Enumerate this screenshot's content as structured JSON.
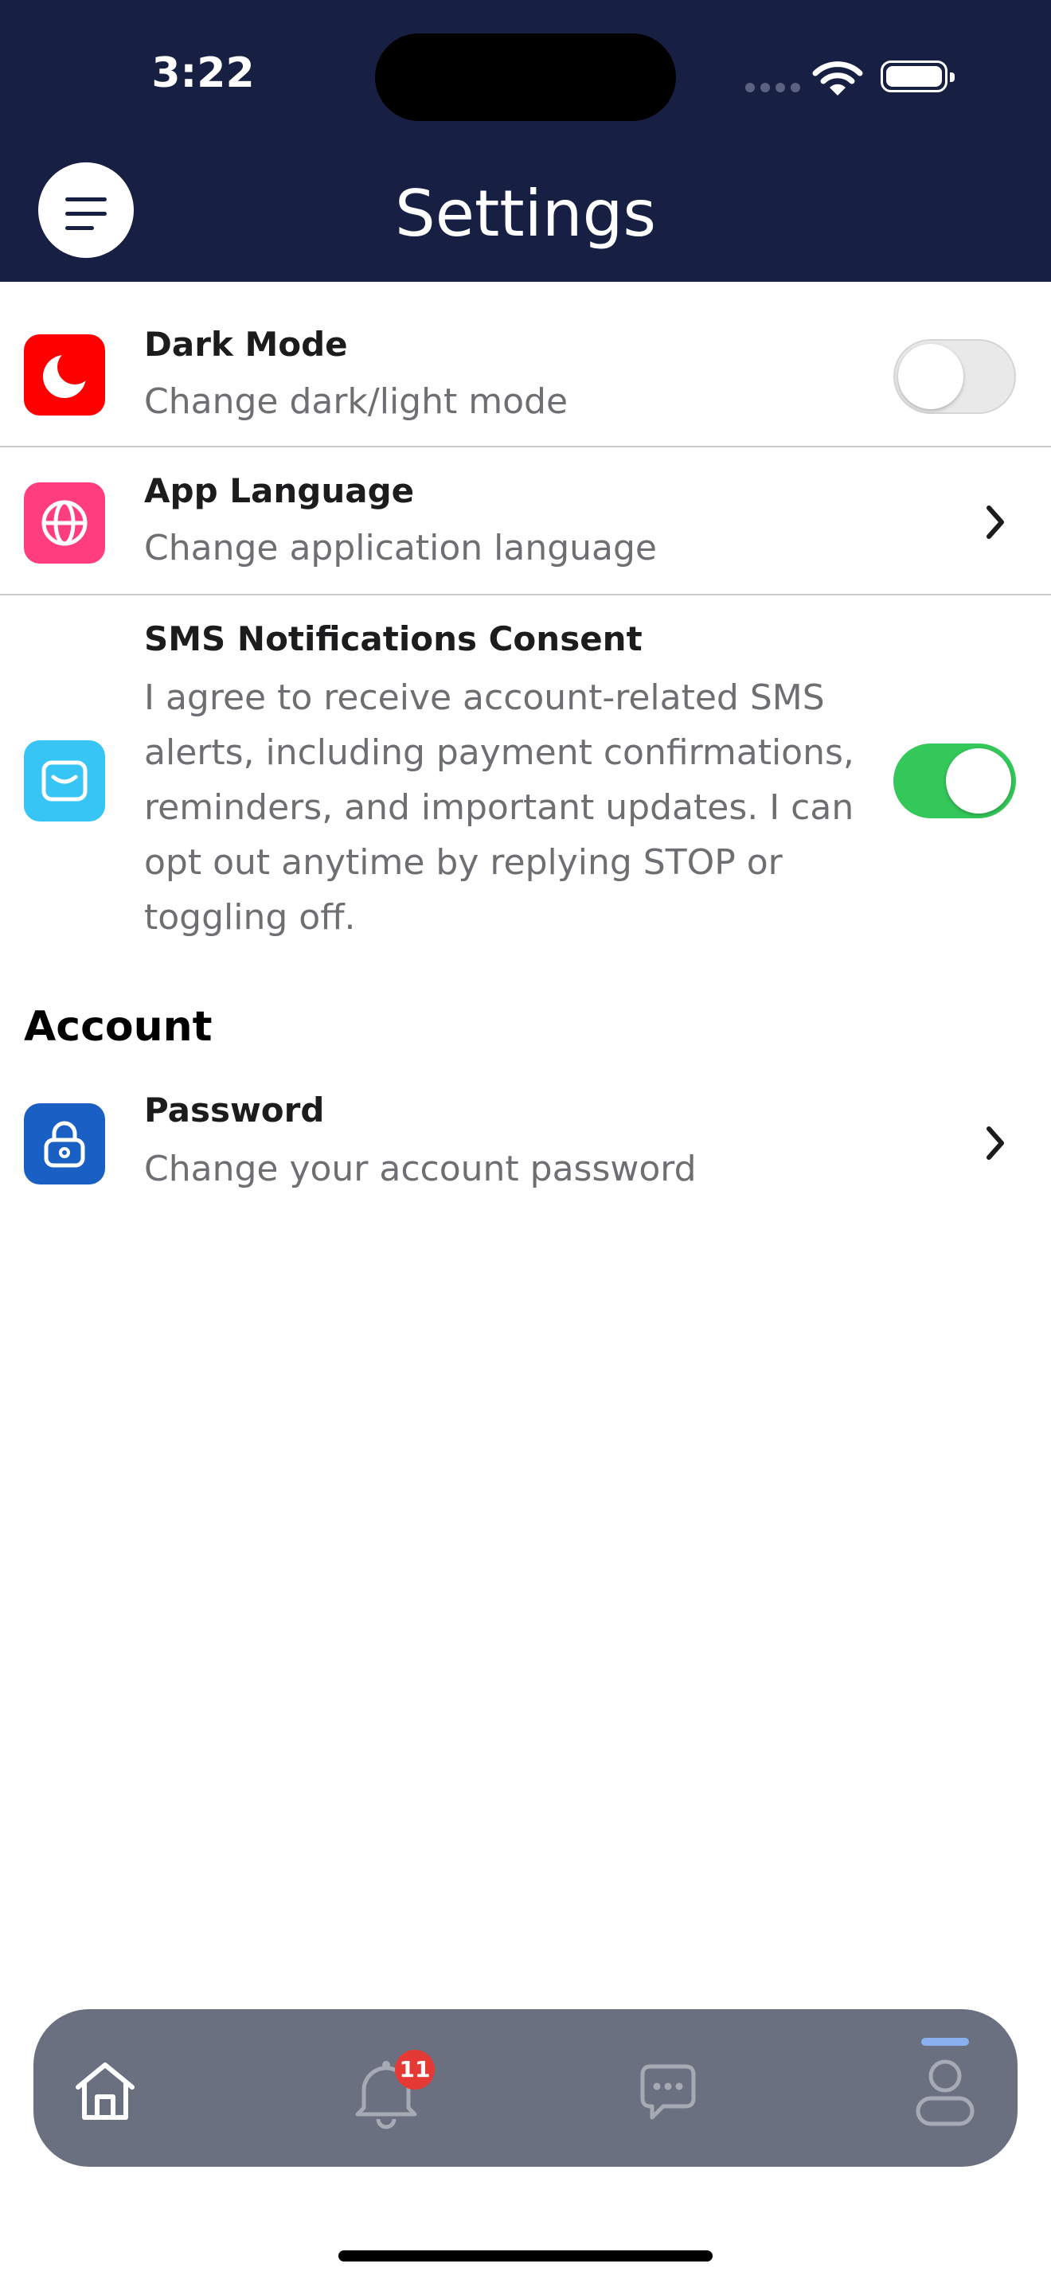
{
  "status_bar": {
    "time": "3:22"
  },
  "header": {
    "title": "Settings",
    "menu_icon": "hamburger-menu-icon"
  },
  "settings": {
    "dark_mode": {
      "title": "Dark Mode",
      "subtitle": "Change dark/light mode",
      "enabled": false,
      "icon": "moon-icon",
      "icon_color": "#ff0000"
    },
    "app_language": {
      "title": "App Language",
      "subtitle": "Change application language",
      "icon": "globe-icon",
      "icon_color": "#ff3d7f"
    },
    "sms_consent": {
      "title": "SMS Notifications Consent",
      "subtitle_lines": [
        "I agree to receive account-related SMS",
        "alerts, including payment confirmations,",
        "reminders, and important updates. I can",
        "opt out anytime by replying STOP or",
        "toggling off."
      ],
      "enabled": true,
      "icon": "message-inbox-icon",
      "icon_color": "#36c5f4"
    }
  },
  "account": {
    "section_title": "Account",
    "password": {
      "title": "Password",
      "subtitle": "Change your account password",
      "icon": "lock-icon",
      "icon_color": "#1a5fc4"
    }
  },
  "tab_bar": {
    "tabs": [
      {
        "name": "home",
        "icon": "home-icon",
        "active": false
      },
      {
        "name": "notifications",
        "icon": "bell-icon",
        "badge": "11"
      },
      {
        "name": "messages",
        "icon": "chat-bubble-icon"
      },
      {
        "name": "profile",
        "icon": "user-icon",
        "active": true
      }
    ]
  },
  "colors": {
    "header_bg": "#172042",
    "toggle_on": "#34c759",
    "tab_bar_bg": "#6b7080",
    "badge": "#e53935"
  }
}
